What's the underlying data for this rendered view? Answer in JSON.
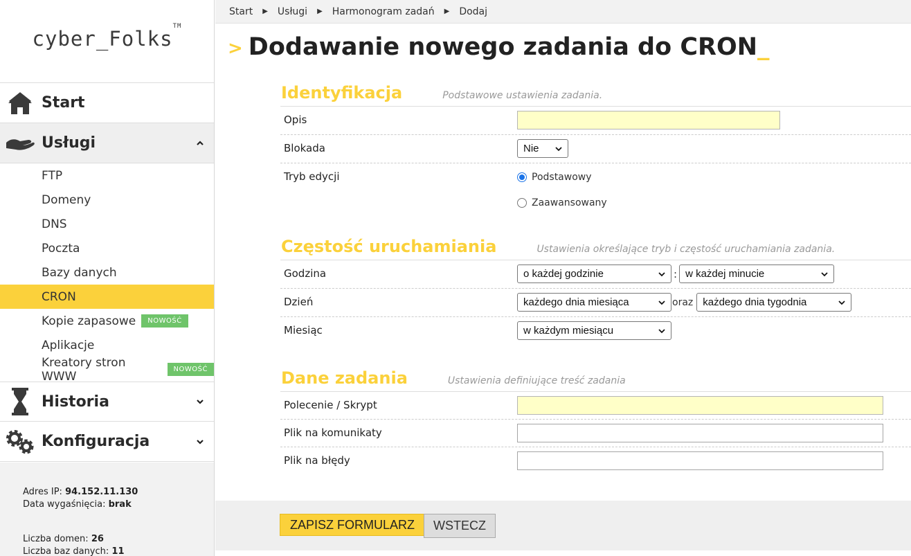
{
  "brand": {
    "logo_text": "cyber_Folks",
    "logo_tm": "TM"
  },
  "sidebar": {
    "start_label": "Start",
    "services_label": "Usługi",
    "services_items": [
      {
        "label": "FTP"
      },
      {
        "label": "Domeny"
      },
      {
        "label": "DNS"
      },
      {
        "label": "Poczta"
      },
      {
        "label": "Bazy danych"
      },
      {
        "label": "CRON",
        "active": true
      },
      {
        "label": "Kopie zapasowe",
        "badge": "NOWOŚĆ"
      },
      {
        "label": "Aplikacje"
      },
      {
        "label": "Kreatory stron WWW",
        "badge": "NOWOŚĆ"
      }
    ],
    "history_label": "Historia",
    "config_label": "Konfiguracja",
    "accent_color": "#fbd13b",
    "badge_color": "#6fc46a"
  },
  "account": {
    "ip_label": "Adres IP:",
    "ip_value": "94.152.11.130",
    "expiry_label": "Data wygaśnięcia:",
    "expiry_value": "brak",
    "domains_label": "Liczba domen:",
    "domains_value": "26",
    "databases_label": "Liczba baz danych:",
    "databases_value": "11"
  },
  "breadcrumb": [
    "Start",
    "Usługi",
    "Harmonogram zadań",
    "Dodaj"
  ],
  "page": {
    "title_prefix": ">",
    "title": "Dodawanie nowego zadania do CRON",
    "title_cursor": "_"
  },
  "sections": {
    "identification": {
      "title": "Identyfikacja",
      "desc": "Podstawowe ustawienia zadania.",
      "desc_label": "Opis",
      "desc_value": "",
      "lock_label": "Blokada",
      "lock_value": "Nie",
      "mode_label": "Tryb edycji",
      "mode_basic": "Podstawowy",
      "mode_advanced": "Zaawansowany"
    },
    "frequency": {
      "title": "Częstość uruchamiania",
      "desc": "Ustawienia określające tryb i częstość uruchamiania zadania.",
      "hour_label": "Godzina",
      "hour_value": "o każdej godzinie",
      "hour_sep": ":",
      "minute_value": "w każdej minucie",
      "day_label": "Dzień",
      "day_value": "każdego dnia miesiąca",
      "day_sep": "oraz",
      "weekday_value": "każdego dnia tygodnia",
      "month_label": "Miesiąc",
      "month_value": "w każdym miesiącu"
    },
    "task": {
      "title": "Dane zadania",
      "desc": "Ustawienia definiujące treść zadania",
      "command_label": "Polecenie / Skrypt",
      "log_label": "Plik na komunikaty",
      "error_label": "Plik na błędy"
    }
  },
  "buttons": {
    "save": "ZAPISZ FORMULARZ",
    "back": "WSTECZ"
  }
}
